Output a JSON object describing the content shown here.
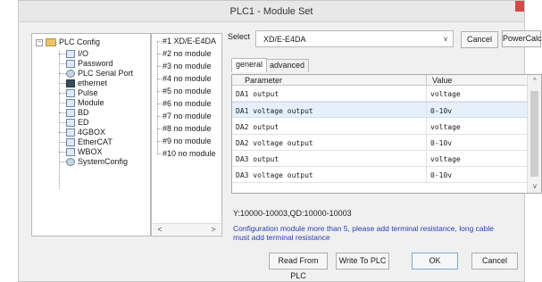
{
  "window": {
    "title": "PLC1 - Module Set"
  },
  "tree": {
    "root": "PLC Config",
    "items": [
      {
        "label": "I/O",
        "icon": "io-icon"
      },
      {
        "label": "Password",
        "icon": "password-icon"
      },
      {
        "label": "PLC Serial Port",
        "icon": "serial-port-icon"
      },
      {
        "label": "ethernet",
        "icon": "ethernet-icon"
      },
      {
        "label": "Pulse",
        "icon": "pulse-icon"
      },
      {
        "label": "Module",
        "icon": "module-icon"
      },
      {
        "label": "BD",
        "icon": "bd-icon"
      },
      {
        "label": "ED",
        "icon": "ed-icon"
      },
      {
        "label": "4GBOX",
        "icon": "4gbox-icon"
      },
      {
        "label": "EtherCAT",
        "icon": "ethercat-icon"
      },
      {
        "label": "WBOX",
        "icon": "wbox-icon"
      },
      {
        "label": "SystemConfig",
        "icon": "system-config-icon"
      }
    ]
  },
  "modules": {
    "items": [
      "#1 XD/E-E4DA",
      "#2 no module",
      "#3 no module",
      "#4 no module",
      "#5 no module",
      "#6 no module",
      "#7 no module",
      "#8 no module",
      "#9 no module",
      "#10 no module"
    ],
    "scroll_left": "<",
    "scroll_right": ">"
  },
  "select": {
    "label": "Select",
    "value": "XD/E-E4DA",
    "arrow": "∨"
  },
  "buttons": {
    "cancel_top": "Cancel",
    "powercalc": "PowerCalc",
    "read_from_plc": "Read From PLC",
    "write_to_plc": "Write To PLC",
    "ok": "OK",
    "cancel_bottom": "Cancel"
  },
  "tabs": {
    "general": "general",
    "advanced": "advanced"
  },
  "grid": {
    "headers": {
      "parameter": "Parameter",
      "value": "Value"
    },
    "rows": [
      {
        "param": "DA1 output",
        "value": "voltage"
      },
      {
        "param": "DA1 voltage output",
        "value": "0-10v"
      },
      {
        "param": "DA2 output",
        "value": "voltage"
      },
      {
        "param": "DA2 voltage output",
        "value": "0-10v"
      },
      {
        "param": "DA3 output",
        "value": "voltage"
      },
      {
        "param": "DA3 voltage output",
        "value": "0-10v"
      }
    ],
    "scroll_up": "^",
    "scroll_down": "v"
  },
  "range_text": "Y:10000-10003,QD:10000-10003",
  "hint_text": "Configuration module more than 5, please add terminal resistance, long cable must add terminal resistance",
  "colors": {
    "hint": "#2a3fb0",
    "selected_row": "#e6f0fb",
    "close": "#d94848"
  }
}
